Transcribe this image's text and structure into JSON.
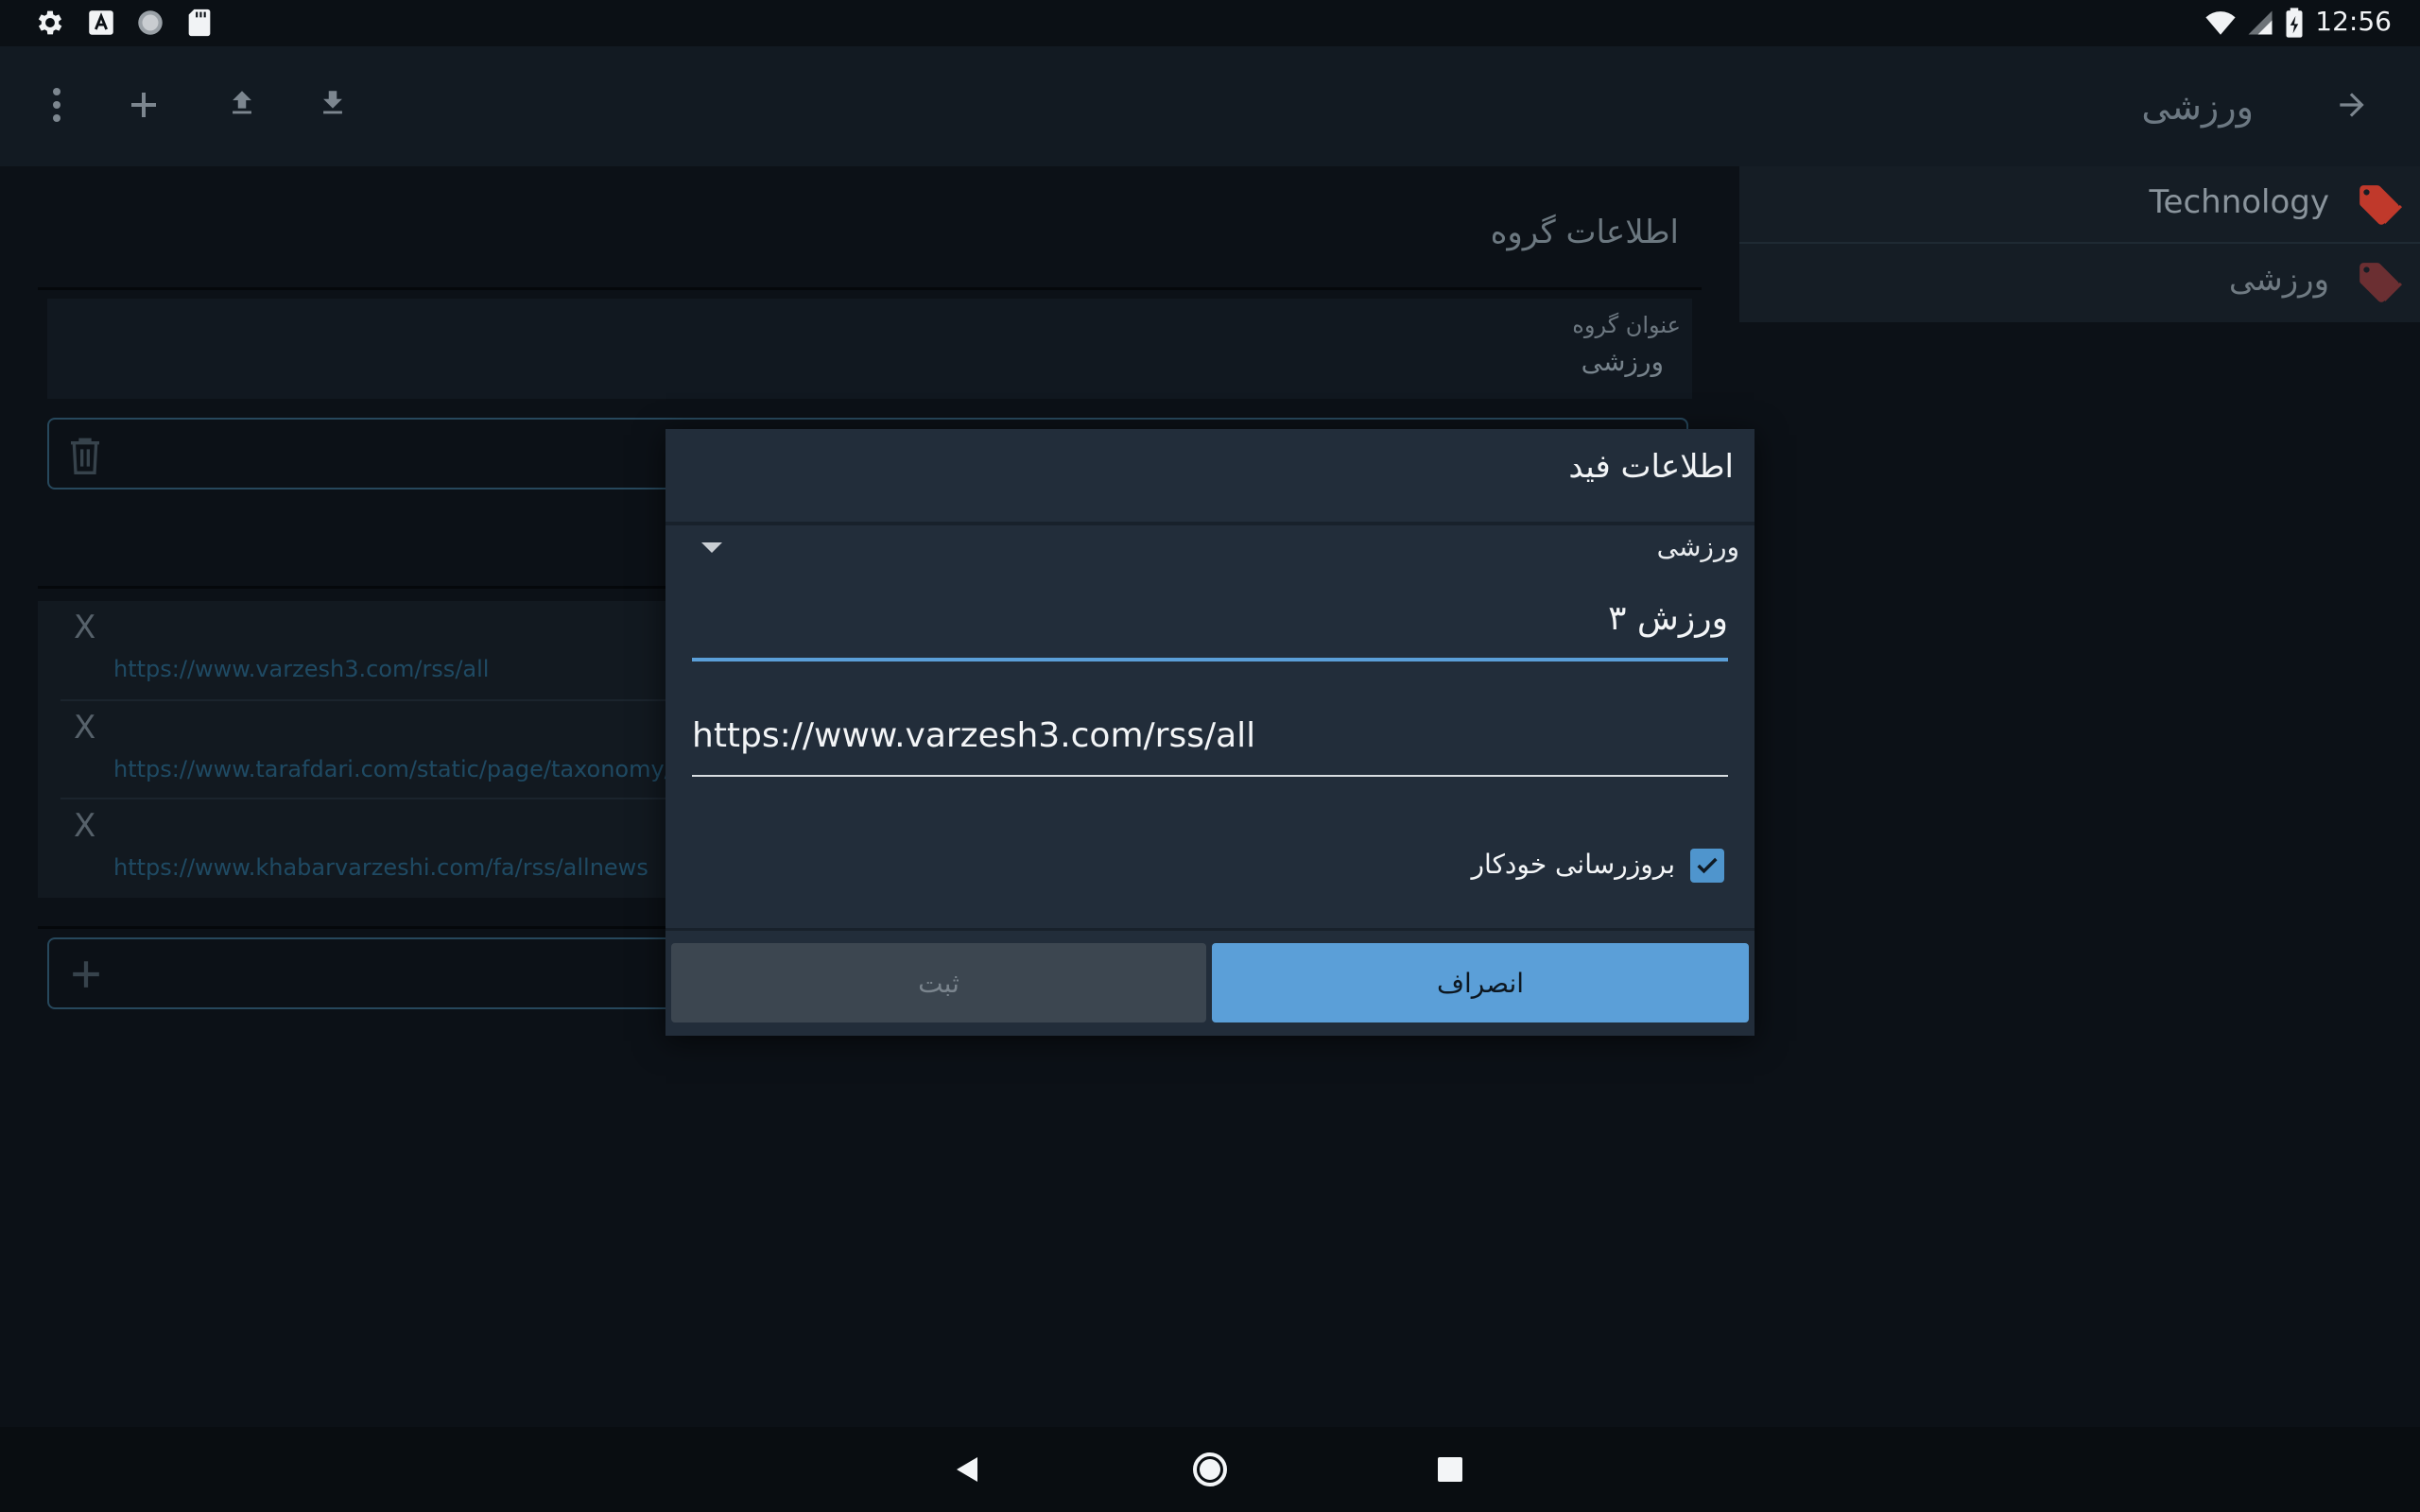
{
  "status_bar": {
    "time": "12:56",
    "left_icons": [
      "gear-icon",
      "keyboard-a-icon",
      "circle-icon",
      "sd-card-icon"
    ],
    "right_icons": [
      "wifi-icon",
      "signal-icon",
      "battery-charging-icon"
    ]
  },
  "toolbar": {
    "title": "ورزشی",
    "icons": [
      "more-vert-icon",
      "add-icon",
      "upload-icon",
      "download-icon",
      "arrow-forward-icon"
    ]
  },
  "tags": [
    {
      "label": "Technology",
      "icon": "tag-icon",
      "color": "#c0392b"
    },
    {
      "label": "ورزشی",
      "icon": "tag-icon",
      "color": "#6b2f32"
    }
  ],
  "group_info": {
    "section_title": "اطلاعات گروه",
    "field_label": "عنوان گروه",
    "field_value": "ورزشی"
  },
  "feeds": [
    {
      "remove_label": "X",
      "url": "https://www.varzesh3.com/rss/all"
    },
    {
      "remove_label": "X",
      "url": "https://www.tarafdari.com/static/page/taxonomy/all/f"
    },
    {
      "remove_label": "X",
      "url": "https://www.khabarvarzeshi.com/fa/rss/allnews"
    }
  ],
  "dialog": {
    "title": "اطلاعات فید",
    "group_select": "ورزشی",
    "name_value": "ورزش ۳",
    "url_value": "https://www.varzesh3.com/rss/all",
    "auto_update_label": "بروزرسانی خودکار",
    "auto_update_checked": true,
    "cancel_label": "انصراف",
    "submit_label": "ثبت"
  },
  "colors": {
    "accent": "#5b9fd8",
    "background": "#0c1117",
    "dialog": "#222d3a",
    "tag_red": "#c0392b"
  }
}
